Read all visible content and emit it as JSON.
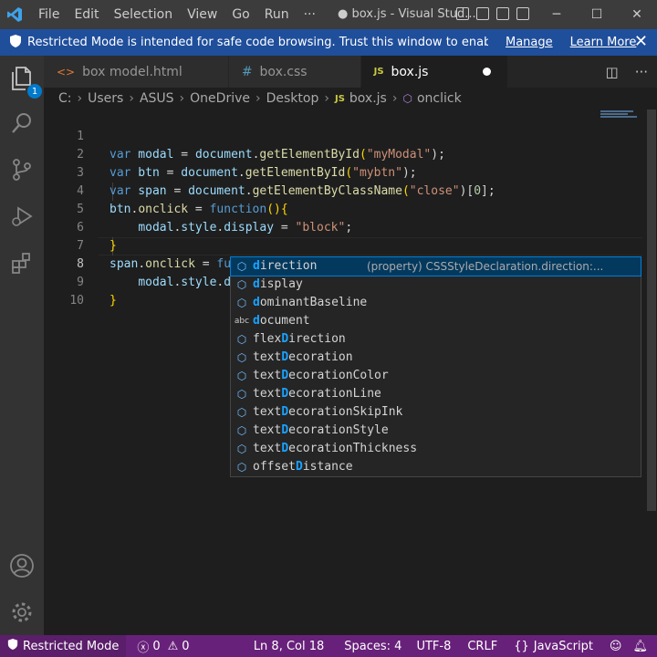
{
  "titlebar": {
    "menus": [
      "File",
      "Edit",
      "Selection",
      "View",
      "Go",
      "Run",
      "···"
    ],
    "title": "● box.js - Visual Stud...",
    "win_controls": [
      "─",
      "☐",
      "✕"
    ]
  },
  "banner": {
    "message": "Restricted Mode is intended for safe code browsing. Trust this window to enable all feat...",
    "manage": "Manage",
    "learn_more": "Learn More",
    "close": "✕"
  },
  "activity": {
    "badge": "1",
    "icons": [
      "explorer-icon",
      "search-icon",
      "source-control-icon",
      "run-debug-icon",
      "extensions-icon",
      "account-icon",
      "settings-gear-icon"
    ]
  },
  "tabs": [
    {
      "label": "box model.html",
      "icon": "<>",
      "color": "#e37933"
    },
    {
      "label": "box.css",
      "icon": "#",
      "color": "#519aba"
    },
    {
      "label": "box.js",
      "icon": "JS",
      "color": "#cbcb41"
    }
  ],
  "breadcrumb": [
    "C:",
    "Users",
    "ASUS",
    "OneDrive",
    "Desktop",
    "box.js",
    "onclick"
  ],
  "line_numbers": [
    "1",
    "2",
    "3",
    "4",
    "5",
    "6",
    "7",
    "8",
    "9",
    "10"
  ],
  "code": {
    "l1": {
      "kw": "var",
      "v": " modal",
      "op": " = ",
      "obj": "document",
      "dot": ".",
      "fn": "getElementById",
      "p1": "(",
      "s": "\"myModal\"",
      "p2": ");"
    },
    "l2": {
      "kw": "var",
      "v": " btn",
      "op": " = ",
      "obj": "document",
      "dot": ".",
      "fn": "getElementById",
      "p1": "(",
      "s": "\"mybtn\"",
      "p2": ");"
    },
    "l3": {
      "kw": "var",
      "v": " span",
      "op": " = ",
      "obj": "document",
      "dot": ".",
      "fn": "getElementByClassName",
      "p1": "(",
      "s": "\"close\"",
      "p2": ")[",
      "n": "0",
      "p3": "];"
    },
    "l4": {
      "a": "btn",
      "b": ".",
      "c": "onclick",
      "d": " = ",
      "kw": "function",
      "e": "(){"
    },
    "l5": {
      "a": "modal",
      "b": ".",
      "c": "style",
      "d": ".",
      "e": "display",
      "f": " = ",
      "s": "\"block\"",
      "g": ";"
    },
    "l6": {
      "a": "}"
    },
    "l7": {
      "a": "span",
      "b": ".",
      "c": "onclick",
      "d": " = ",
      "kw": "function",
      "e": "(){"
    },
    "l8": {
      "a": "modal",
      "b": ".",
      "c": "style",
      "d": ".",
      "e": "d"
    },
    "l9": {
      "a": "}"
    }
  },
  "suggestions": [
    {
      "pre": "",
      "hl": "d",
      "post": "irection",
      "icon": "property",
      "detail": "(property) CSSStyleDeclaration.direction:..."
    },
    {
      "pre": "",
      "hl": "d",
      "post": "isplay",
      "icon": "property"
    },
    {
      "pre": "",
      "hl": "d",
      "post": "ominantBaseline",
      "icon": "property"
    },
    {
      "pre": "",
      "hl": "d",
      "post": "ocument",
      "icon": "word"
    },
    {
      "pre": "flex",
      "hl": "D",
      "post": "irection",
      "icon": "property"
    },
    {
      "pre": "text",
      "hl": "D",
      "post": "ecoration",
      "icon": "property"
    },
    {
      "pre": "text",
      "hl": "D",
      "post": "ecorationColor",
      "icon": "property"
    },
    {
      "pre": "text",
      "hl": "D",
      "post": "ecorationLine",
      "icon": "property"
    },
    {
      "pre": "text",
      "hl": "D",
      "post": "ecorationSkipInk",
      "icon": "property"
    },
    {
      "pre": "text",
      "hl": "D",
      "post": "ecorationStyle",
      "icon": "property"
    },
    {
      "pre": "text",
      "hl": "D",
      "post": "ecorationThickness",
      "icon": "property"
    },
    {
      "pre": "offset",
      "hl": "D",
      "post": "istance",
      "icon": "property"
    }
  ],
  "suggest_icons": {
    "property": "⬡",
    "word": "abc"
  },
  "statusbar": {
    "restricted": "Restricted Mode",
    "errors": "0",
    "warnings": "0",
    "position": "Ln 8, Col 18",
    "spaces": "Spaces: 4",
    "encoding": "UTF-8",
    "eol": "CRLF",
    "language": "JavaScript"
  },
  "colors": {
    "statusbar": "#68217a",
    "banner": "#1f4e9b",
    "accent": "#007acc"
  }
}
